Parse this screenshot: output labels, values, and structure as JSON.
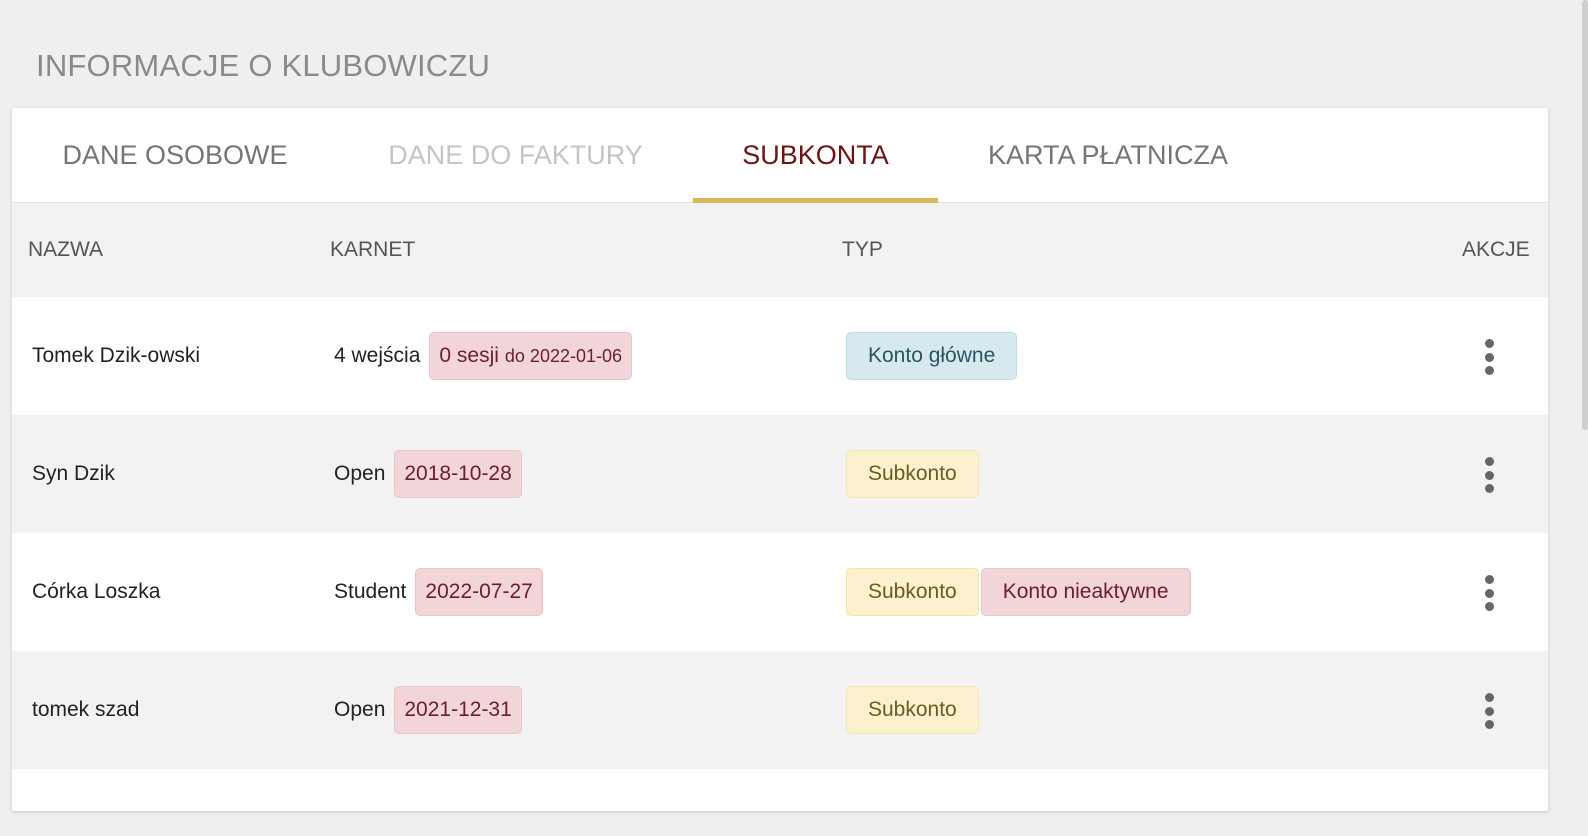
{
  "section_title": "INFORMACJE O KLUBOWICZU",
  "tabs": [
    {
      "label": "DANE OSOBOWE",
      "state": "normal"
    },
    {
      "label": "DANE DO FAKTURY",
      "state": "disabled"
    },
    {
      "label": "SUBKONTA",
      "state": "active"
    },
    {
      "label": "KARTA PŁATNICZA",
      "state": "normal"
    }
  ],
  "table": {
    "headers": {
      "name": "NAZWA",
      "pass": "KARNET",
      "type": "TYP",
      "actions": "AKCJE"
    },
    "rows": [
      {
        "name": "Tomek Dzik-owski",
        "pass": "4 wejścia",
        "pass_badge": "0 sesji",
        "pass_badge_small": "do 2022-01-06",
        "types": [
          "Konto główne"
        ]
      },
      {
        "name": "Syn Dzik",
        "pass": "Open",
        "pass_badge": "2018-10-28",
        "types": [
          "Subkonto"
        ]
      },
      {
        "name": "Córka Loszka",
        "pass": "Student",
        "pass_badge": "2022-07-27",
        "types": [
          "Subkonto",
          "Konto nieaktywne"
        ]
      },
      {
        "name": "tomek szad",
        "pass": "Open",
        "pass_badge": "2021-12-31",
        "types": [
          "Subkonto"
        ]
      }
    ]
  },
  "icons": {
    "row_actions": "kebab-menu-icon"
  },
  "colors": {
    "active_tab_text": "#6a1414",
    "tab_indicator": "#d9b85a",
    "badge_date_bg": "#f2d5d8",
    "badge_main_account_bg": "#d5e9ef",
    "badge_subaccount_bg": "#fbf1cf"
  }
}
